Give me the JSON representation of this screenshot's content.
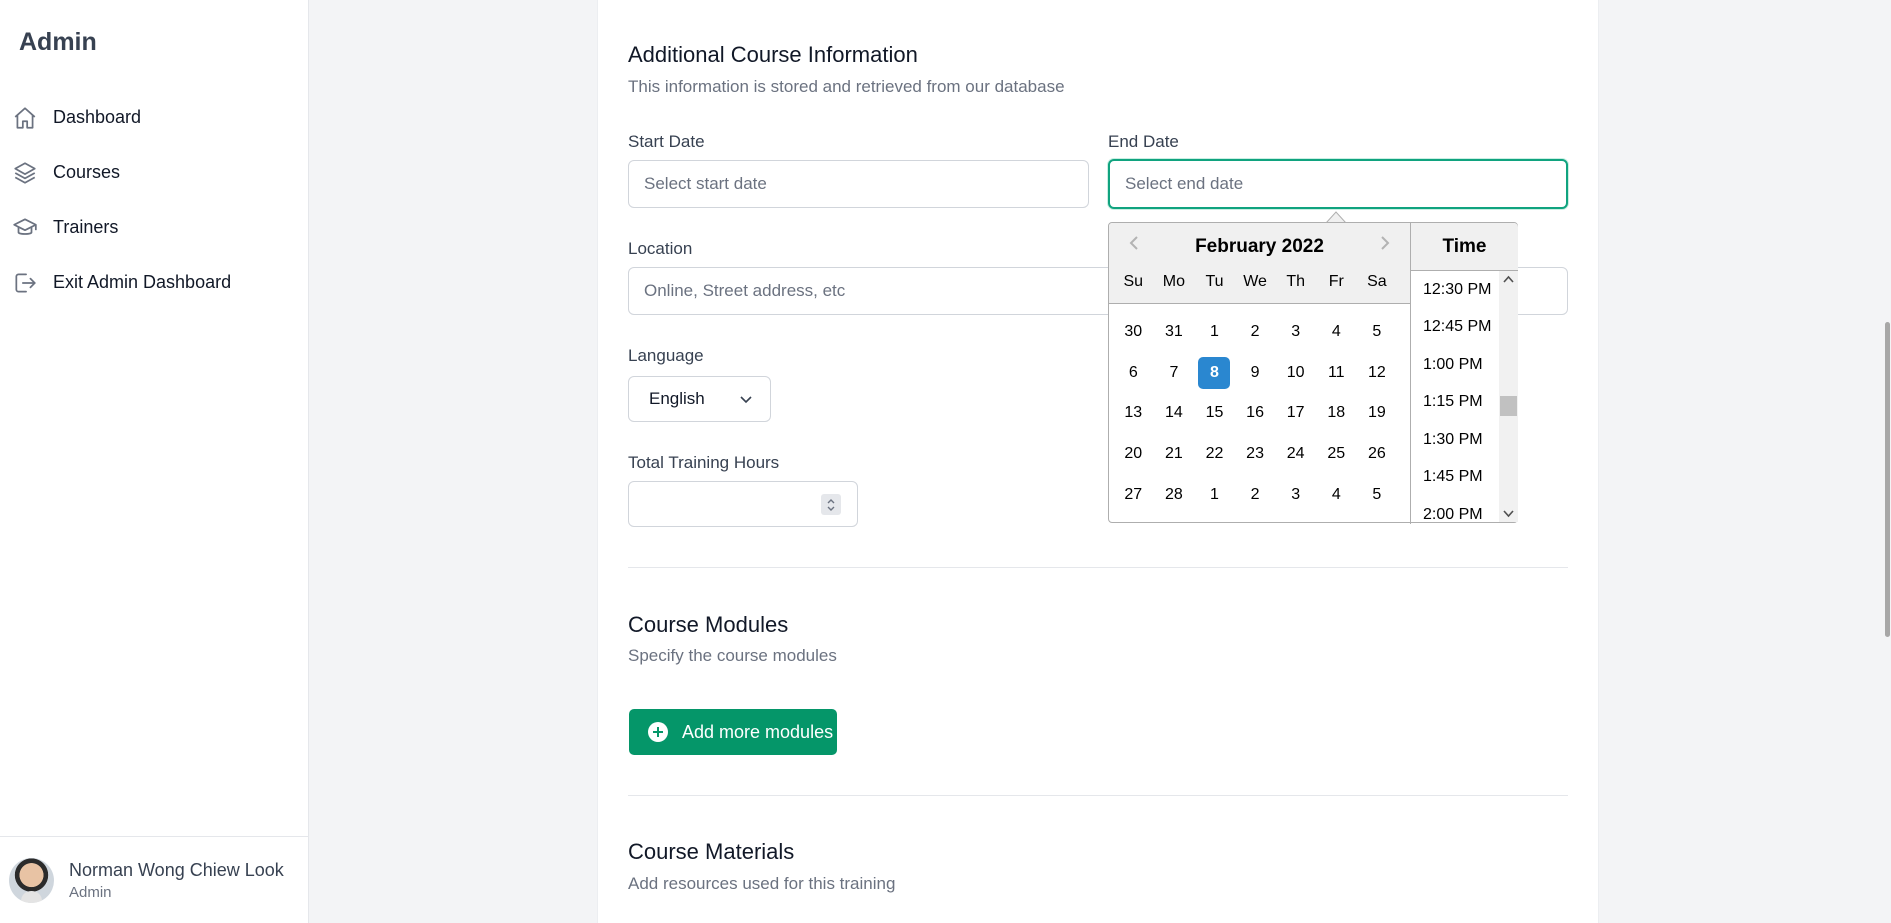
{
  "sidebar": {
    "brand": "Admin",
    "items": [
      {
        "label": "Dashboard",
        "icon": "home-icon"
      },
      {
        "label": "Courses",
        "icon": "layers-icon"
      },
      {
        "label": "Trainers",
        "icon": "graduation-cap-icon"
      },
      {
        "label": "Exit Admin Dashboard",
        "icon": "logout-icon"
      }
    ],
    "user": {
      "name": "Norman Wong Chiew Look",
      "role": "Admin"
    }
  },
  "course_info": {
    "title": "Additional Course Information",
    "subtitle": "This information is stored and retrieved from our database",
    "start_date": {
      "label": "Start Date",
      "placeholder": "Select start date",
      "value": ""
    },
    "end_date": {
      "label": "End Date",
      "placeholder": "Select end date",
      "value": ""
    },
    "location": {
      "label": "Location",
      "placeholder": "Online, Street address, etc",
      "value": ""
    },
    "language": {
      "label": "Language",
      "value": "English"
    },
    "training_hours": {
      "label": "Total Training Hours",
      "value": ""
    }
  },
  "modules": {
    "title": "Course Modules",
    "subtitle": "Specify the course modules",
    "add_button": "Add more modules"
  },
  "materials": {
    "title": "Course Materials",
    "subtitle": "Add resources used for this training"
  },
  "datepicker": {
    "month_label": "February 2022",
    "weekdays": [
      "Su",
      "Mo",
      "Tu",
      "We",
      "Th",
      "Fr",
      "Sa"
    ],
    "weeks": [
      [
        "30",
        "31",
        "1",
        "2",
        "3",
        "4",
        "5"
      ],
      [
        "6",
        "7",
        "8",
        "9",
        "10",
        "11",
        "12"
      ],
      [
        "13",
        "14",
        "15",
        "16",
        "17",
        "18",
        "19"
      ],
      [
        "20",
        "21",
        "22",
        "23",
        "24",
        "25",
        "26"
      ],
      [
        "27",
        "28",
        "1",
        "2",
        "3",
        "4",
        "5"
      ]
    ],
    "selected_day": "8",
    "time_header": "Time",
    "times": [
      "12:30 PM",
      "12:45 PM",
      "1:00 PM",
      "1:15 PM",
      "1:30 PM",
      "1:45 PM",
      "2:00 PM"
    ]
  },
  "colors": {
    "accent": "#059669",
    "focus_border": "#10a37f",
    "selected_day": "#2a87d0"
  }
}
